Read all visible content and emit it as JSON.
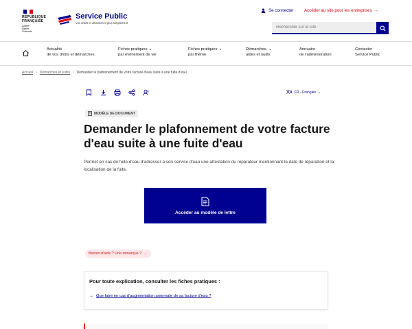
{
  "header": {
    "republique": [
      "RÉPUBLIQUE",
      "FRANÇAISE"
    ],
    "motto": [
      "Liberté",
      "Égalité",
      "Fraternité"
    ],
    "site_name": "Service Public",
    "tagline": "Vos droits et démarches plus simplement",
    "connect_label": "Se connecter",
    "pro_label": "Accéder au site pour les entreprises",
    "search_placeholder": "Rechercher sur le site",
    "colors": {
      "blue": "#000091",
      "red": "#e1000f"
    }
  },
  "nav": {
    "items": [
      {
        "line1": "Actualité",
        "line2": "de vos droits et démarches",
        "chevron": false
      },
      {
        "line1": "Fiches pratiques",
        "line2": "par événement de vie",
        "chevron": true
      },
      {
        "line1": "Fiches pratiques",
        "line2": "par thème",
        "chevron": true
      },
      {
        "line1": "Démarches,",
        "line2": "aides et outils",
        "chevron": true
      },
      {
        "line1": "Annuaire",
        "line2": "de l'administration",
        "chevron": false
      },
      {
        "line1": "Contacter",
        "line2": "Service Public",
        "chevron": false
      }
    ]
  },
  "breadcrumb": {
    "items": [
      "Accueil",
      "Démarches et outils",
      "Demander le plafonnement de votre facture d'eau suite à une fuite d'eau"
    ]
  },
  "toolbar": {
    "icons": [
      "bookmark-icon",
      "download-icon",
      "print-icon",
      "share-icon",
      "listen-icon"
    ],
    "language": "FR - Français"
  },
  "main": {
    "badge": "MODÈLE DE DOCUMENT",
    "title": "Demander le plafonnement de votre facture d'eau suite à une fuite d'eau",
    "description": "Permet en cas de fuite d'eau d'adresser à son service d'eau une attestation du réparateur mentionnant la date de réparation et la localisation de la fuite.",
    "cta_label": "Accéder au modèle de lettre",
    "help_label": "Besoin d'aide ? Une remarque ?",
    "explain_title": "Pour toute explication, consulter les fiches pratiques :",
    "explain_link": "Que faire en cas d'augmentation anormale de sa facture d'eau ?"
  }
}
